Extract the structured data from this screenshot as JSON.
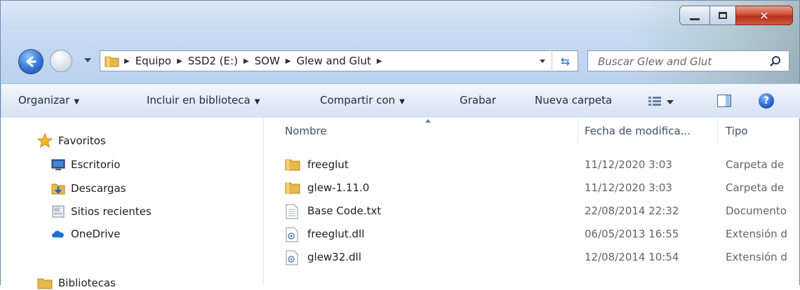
{
  "address_bar": {
    "crumbs": [
      "Equipo",
      "SSD2 (E:)",
      "SOW",
      "Glew and Glut"
    ]
  },
  "search": {
    "placeholder": "Buscar Glew and Glut"
  },
  "toolbar": {
    "organize": "Organizar",
    "include_library": "Incluir en biblioteca",
    "share_with": "Compartir con",
    "burn": "Grabar",
    "new_folder": "Nueva carpeta"
  },
  "nav_pane": {
    "favorites": "Favoritos",
    "items": [
      {
        "label": "Escritorio",
        "icon": "desktop-icon"
      },
      {
        "label": "Descargas",
        "icon": "downloads-icon"
      },
      {
        "label": "Sitios recientes",
        "icon": "recent-places-icon"
      },
      {
        "label": "OneDrive",
        "icon": "onedrive-icon"
      }
    ],
    "libraries": "Bibliotecas"
  },
  "file_list": {
    "columns": {
      "name": "Nombre",
      "date": "Fecha de modifica...",
      "type": "Tipo"
    },
    "rows": [
      {
        "name": "freeglut",
        "date": "11/12/2020 3:03",
        "type": "Carpeta de",
        "icon": "folder-icon"
      },
      {
        "name": "glew-1.11.0",
        "date": "11/12/2020 3:03",
        "type": "Carpeta de",
        "icon": "folder-icon"
      },
      {
        "name": "Base Code.txt",
        "date": "22/08/2014 22:32",
        "type": "Documento",
        "icon": "text-file-icon"
      },
      {
        "name": "freeglut.dll",
        "date": "06/05/2013 16:55",
        "type": "Extensión d",
        "icon": "dll-file-icon"
      },
      {
        "name": "glew32.dll",
        "date": "12/08/2014 10:54",
        "type": "Extensión d",
        "icon": "dll-file-icon"
      }
    ]
  },
  "colors": {
    "close_button": "#c9452f",
    "toolbar_bg": "#e3ecf7",
    "header_text": "#3d4f6b",
    "secondary_text": "#5c6470"
  }
}
